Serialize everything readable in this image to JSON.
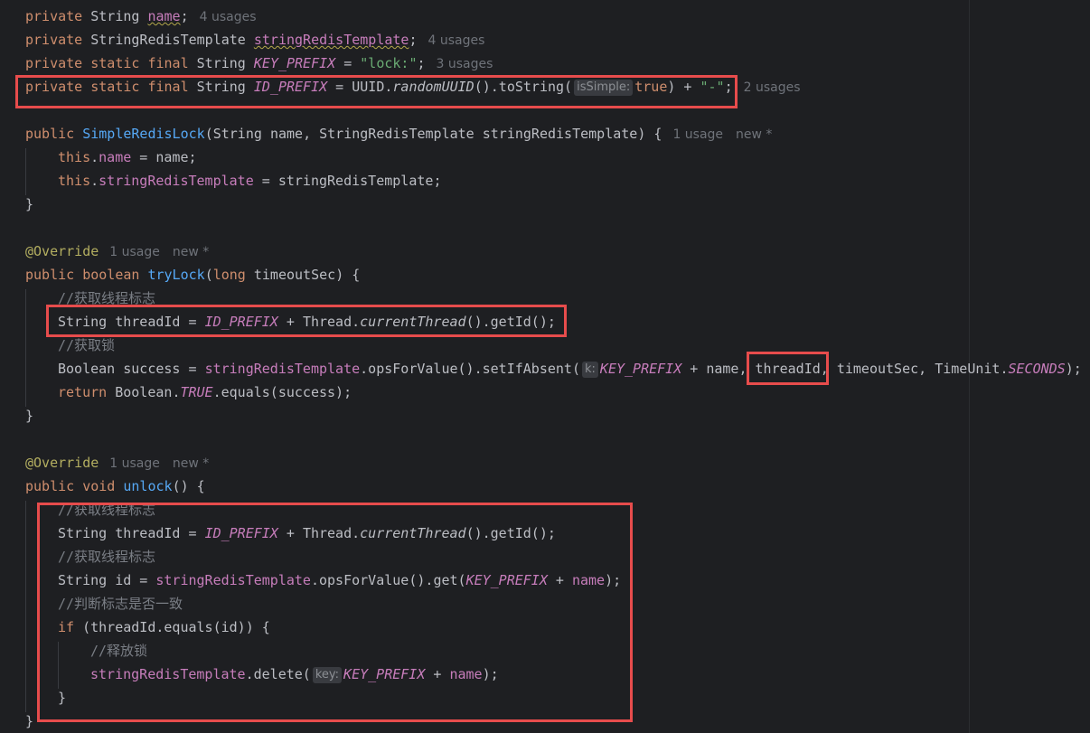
{
  "code": {
    "kw_private": "private",
    "kw_public": "public",
    "kw_static": "static",
    "kw_final": "final",
    "kw_boolean": "boolean",
    "kw_void": "void",
    "kw_long": "long",
    "kw_this": "this",
    "kw_return": "return",
    "kw_if": "if",
    "type_string": "String",
    "type_redis": "StringRedisTemplate",
    "type_boolean_cls": "Boolean",
    "type_thread": "Thread",
    "type_uuid": "UUID",
    "type_timeunit": "TimeUnit",
    "fld_name": "name",
    "fld_template": "stringRedisTemplate",
    "const_key_prefix": "KEY_PREFIX",
    "const_id_prefix": "ID_PREFIX",
    "const_true": "TRUE",
    "const_seconds": "SECONDS",
    "str_lock": "\"lock:\"",
    "str_dash": "\"-\"",
    "kw_true": "true",
    "m_random_uuid": "randomUUID",
    "m_current_thread": "currentThread",
    "fn_constructor": "SimpleRedisLock",
    "fn_trylock": "tryLock",
    "fn_unlock": "unlock",
    "ann_override": "@Override",
    "p_name": "name",
    "p_template": "stringRedisTemplate",
    "p_timeout": "timeoutSec",
    "v_thread_id": "threadId",
    "v_success": "success",
    "v_id": "id",
    "cmt_get_thread_id": "//获取线程标志",
    "cmt_get_lock": "//获取锁",
    "cmt_compare": "//判断标志是否一致",
    "cmt_release": "//释放锁",
    "sep_semicolon": ";",
    "sep_assign": " = ",
    "sep_brace_close": "}",
    "sep_space": " ",
    "sep_comma_space": ", ",
    "sep_dot": ".",
    "sep_plus": " + ",
    "sep_lparen": "(",
    "sep_paren_brace": ") {",
    "sep_call_dot": "().",
    "sep_getid": "getId();",
    "sep_tostring": "().toString(",
    "sep_opsforvalue": ".opsForValue().",
    "sep_setifabsent": "setIfAbsent(",
    "sep_get": "get(",
    "sep_delete": ".delete(",
    "sep_close_semicolon": ");",
    "sep_equals_success": ".equals(success);",
    "sep_if_threadid": " (threadId.equals(id)) {",
    "sep_paren_semicolon": "();",
    "sep_unlock_sig": "() {",
    "sep_trylock_sig": "(long timeoutSec) {"
  },
  "hints": {
    "usages_4": "4 usages",
    "usages_3": "3 usages",
    "usages_2": "2 usages",
    "usages_1": "1 usage",
    "new_marker": "new *"
  },
  "params": {
    "is_simple": "isSimple:",
    "k": "k:",
    "key": "key:"
  },
  "colors": {
    "background": "#1e1f22",
    "keyword": "#cf8e6d",
    "field": "#c77dbb",
    "function": "#56a8f5",
    "string": "#6aab73",
    "annotation": "#b3ae60",
    "comment": "#7a7e85",
    "highlight_box": "#e74c4c"
  }
}
